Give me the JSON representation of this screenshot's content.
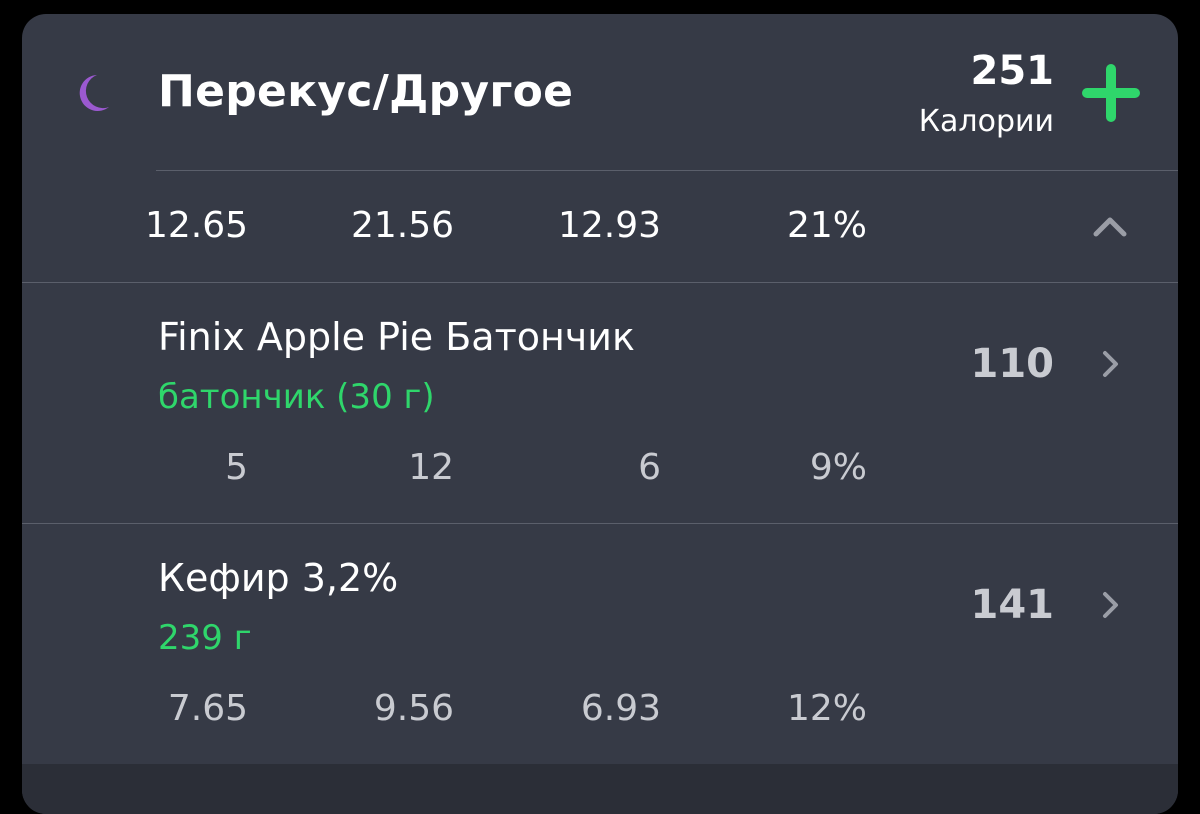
{
  "meal": {
    "icon": "moon-icon",
    "title": "Перекус/Другое",
    "calories_value": "251",
    "calories_label": "Калории",
    "add_icon": "plus-icon",
    "accent_color": "#2fd66b",
    "icon_color": "#9b59d0"
  },
  "totals": {
    "macros": [
      "12.65",
      "21.56",
      "12.93",
      "21%"
    ],
    "collapse_icon": "chevron-up-icon"
  },
  "items": [
    {
      "name": "Finix Apple Pie Батончик",
      "portion": "батончик (30 г)",
      "calories": "110",
      "macros": [
        "5",
        "12",
        "6",
        "9%"
      ],
      "chevron_icon": "chevron-right-icon"
    },
    {
      "name": "Кефир 3,2%",
      "portion": "239 г",
      "calories": "141",
      "macros": [
        "7.65",
        "9.56",
        "6.93",
        "12%"
      ],
      "chevron_icon": "chevron-right-icon"
    }
  ]
}
